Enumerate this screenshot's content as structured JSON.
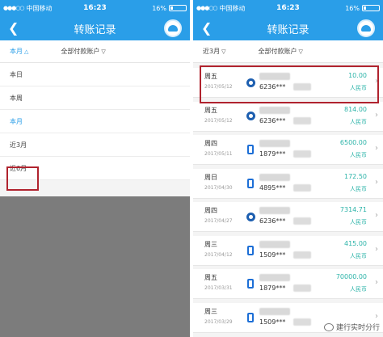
{
  "status": {
    "carrier": "中国移动",
    "time": "16:23",
    "battery": "16%",
    "battery_level": 0.16
  },
  "title": "转账记录",
  "left": {
    "filter_period": "本月",
    "filter_account": "全部付款账户",
    "dropdown": [
      "本日",
      "本周",
      "本月",
      "近3月",
      "近6月"
    ],
    "selected": "本月"
  },
  "right": {
    "filter_period": "近3月",
    "filter_account": "全部付款账户",
    "records": [
      {
        "day": "周五",
        "date": "2017/05/12",
        "account": "6236***",
        "amount": "10.00",
        "currency": "人民币",
        "icon": "ccb-logo-icon"
      },
      {
        "day": "周五",
        "date": "2017/05/12",
        "account": "6236***",
        "amount": "814.00",
        "currency": "人民币",
        "icon": "ccb-logo-icon"
      },
      {
        "day": "周四",
        "date": "2017/05/11",
        "account": "1879***",
        "amount": "6500.00",
        "currency": "人民币",
        "icon": "phone-icon"
      },
      {
        "day": "周日",
        "date": "2017/04/30",
        "account": "4895***",
        "amount": "172.50",
        "currency": "人民币",
        "icon": "phone-icon"
      },
      {
        "day": "周四",
        "date": "2017/04/27",
        "account": "6236***",
        "amount": "7314.71",
        "currency": "人民币",
        "icon": "ccb-logo-icon"
      },
      {
        "day": "周三",
        "date": "2017/04/12",
        "account": "1509***",
        "amount": "415.00",
        "currency": "人民币",
        "icon": "phone-icon"
      },
      {
        "day": "周五",
        "date": "2017/03/31",
        "account": "1879***",
        "amount": "70000.00",
        "currency": "人民币",
        "icon": "phone-icon"
      },
      {
        "day": "周三",
        "date": "2017/03/29",
        "account": "1509***",
        "amount": "",
        "currency": "",
        "icon": "phone-icon"
      }
    ]
  },
  "watermark": "建行实时分行"
}
